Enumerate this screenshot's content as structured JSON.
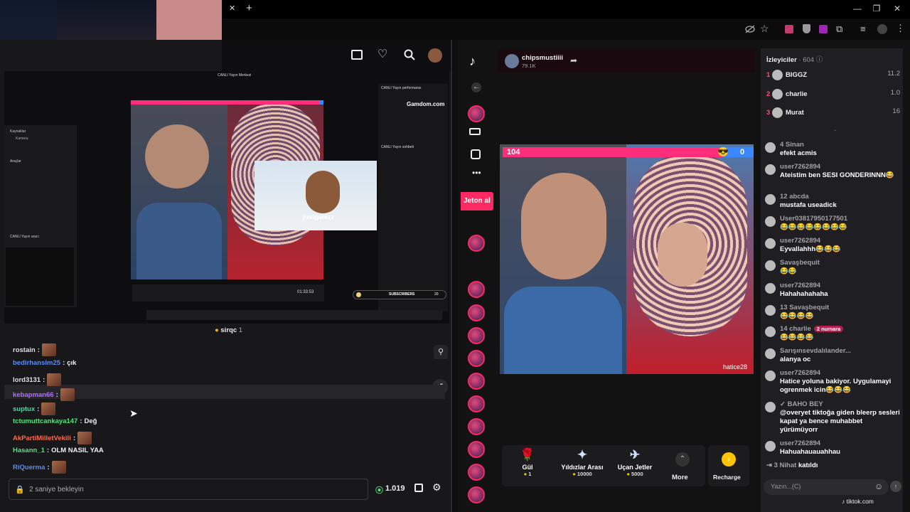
{
  "browser": {
    "close_tab": "✕",
    "new_tab": "+",
    "win_min": "—",
    "win_max": "❐",
    "win_close": "✕"
  },
  "twitch": {
    "mini_header": "sirqc",
    "mini_count": "1",
    "overlay_name": "justgarezz",
    "subscribers_label": "SUBSCRIBERS",
    "subscribers_count": "20",
    "gamdom": "Gamdom.com",
    "inner": {
      "canli_yayin_performansi": "CANLI Yayın performansı",
      "canli_yayin_sohbeti": "CANLI Yayın sohbeti",
      "arac": "Araçlar",
      "kaynaklar": "Kaynaklar",
      "kamera": "Kamera",
      "canli_yayin_araci": "CANLI Yayın aracı",
      "canli_yayin_merkezi": "CANLI Yayın Merkezi",
      "viewer_score_left": "104",
      "viewer_score_right": "0",
      "timer": "01:33:53"
    },
    "chat_lines": [
      {
        "user": "rostain",
        "color": "#e0e0e0",
        "sep": ":",
        "msg": ""
      },
      {
        "user": "bedirhanslm25",
        "color": "#5c8bf5",
        "sep": ":",
        "msg": "çık"
      },
      {
        "user": "lord3131",
        "color": "#e0e0e0",
        "sep": ":",
        "msg": ""
      },
      {
        "user": "kebapman66",
        "color": "#b26fff",
        "sep": ":",
        "msg": ""
      },
      {
        "user": "suptux",
        "color": "#3ee0a0",
        "sep": ":",
        "msg": ""
      },
      {
        "user": "tctumuttcankaya147",
        "color": "#52e37d",
        "sep": ":",
        "msg": "Değ"
      },
      {
        "user": "AkPartiMilletVekili",
        "color": "#ff6a4a",
        "sep": ":",
        "msg": ""
      },
      {
        "user": "Hasann_1",
        "color": "#52e37d",
        "sep": ":",
        "msg": "OLM NASIL YAA"
      },
      {
        "user": "RiQuerma",
        "color": "#5c8bf5",
        "sep": ":",
        "msg": ""
      }
    ],
    "input_placeholder": "2 saniye bekleyin",
    "points": "1.019"
  },
  "tiktok": {
    "host_name": "chipsmustiiii",
    "host_likes": "79.1K",
    "jeton_banner": "Jeton al",
    "battle_left_score": "104",
    "battle_right_score": "0",
    "guest_name": "hatice28",
    "viewers_title": "İzleyiciler",
    "viewers_count": "604",
    "top_viewers": [
      {
        "rank": "1",
        "name": "BIGGZ",
        "score": "11.2"
      },
      {
        "rank": "2",
        "name": "charlie",
        "score": "1.0"
      },
      {
        "rank": "3",
        "name": "Murat",
        "score": "16"
      }
    ],
    "messages": [
      {
        "user": "4  Sinan",
        "text": "efekt acmis"
      },
      {
        "user": "user7262894",
        "text": "Ateistim ben SESI GONDERINNN😂"
      },
      {
        "user": "12  abcda",
        "text": "mustafa useadick"
      },
      {
        "user": "User03817950177501",
        "text": "😂😂😂😂😂😂😂😂"
      },
      {
        "user": "user7262894",
        "text": "Eyvallahhh😂😂😂"
      },
      {
        "user": "Savaşbequit",
        "text": "😂😂"
      },
      {
        "user": "user7262894",
        "text": "Hahahahahaha"
      },
      {
        "user": "13  Savaşbequit",
        "text": "😂😂😂😂"
      },
      {
        "user": "14  charlie",
        "text": "😂😂😂😂",
        "badge": "2 numara"
      },
      {
        "user": "Sarışınsevdalılander...",
        "text": "alanya oc"
      },
      {
        "user": "user7262894",
        "text": "Hatice yoluna bakiyor. Uygulamayi ogrenmek icin😂😂😂"
      },
      {
        "user": "✓ BAHO BEY",
        "text": "@overyet tiktoğa giden bleerp sesleri kapat ya bence muhabbet yürümüyorr"
      },
      {
        "user": "user7262894",
        "text": "Hahuahauauahhau"
      }
    ],
    "join_line_user": "3  Nihat",
    "join_line_text": "katıldı",
    "gifts": [
      {
        "name": "Gül",
        "price": "1"
      },
      {
        "name": "Yıldızlar Arası",
        "price": "10000"
      },
      {
        "name": "Uçan Jetler",
        "price": "5000"
      }
    ],
    "more_label": "More",
    "recharge_label": "Recharge",
    "chat_placeholder": "Yazın...(C)",
    "domain": "tiktok.com"
  }
}
